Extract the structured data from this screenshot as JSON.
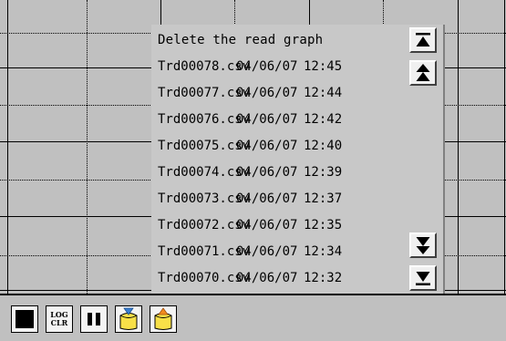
{
  "dialog": {
    "title": "Delete the read graph",
    "rows": [
      {
        "file": "Trd00078.csv",
        "date": "04/06/07",
        "time": "12:45"
      },
      {
        "file": "Trd00077.csv",
        "date": "04/06/07",
        "time": "12:44"
      },
      {
        "file": "Trd00076.csv",
        "date": "04/06/07",
        "time": "12:42"
      },
      {
        "file": "Trd00075.csv",
        "date": "04/06/07",
        "time": "12:40"
      },
      {
        "file": "Trd00074.csv",
        "date": "04/06/07",
        "time": "12:39"
      },
      {
        "file": "Trd00073.csv",
        "date": "04/06/07",
        "time": "12:37"
      },
      {
        "file": "Trd00072.csv",
        "date": "04/06/07",
        "time": "12:35"
      },
      {
        "file": "Trd00071.csv",
        "date": "04/06/07",
        "time": "12:34"
      },
      {
        "file": "Trd00070.csv",
        "date": "04/06/07",
        "time": "12:32"
      }
    ],
    "scroll_icons": [
      "scroll-top-icon",
      "page-up-icon",
      "page-down-icon",
      "scroll-bottom-icon"
    ]
  },
  "toolbar": {
    "log_clr_line1": "LOG",
    "log_clr_line2": "CLR",
    "icons": [
      "stop-icon",
      "log-clear-icon",
      "pause-icon",
      "load-file-icon",
      "save-file-icon"
    ]
  },
  "colors": {
    "background": "#c0c0c0",
    "button_face": "#f0f0f0",
    "folder_yellow": "#f8e048",
    "arrow_blue": "#3a7fd0",
    "arrow_orange": "#f08a20"
  }
}
